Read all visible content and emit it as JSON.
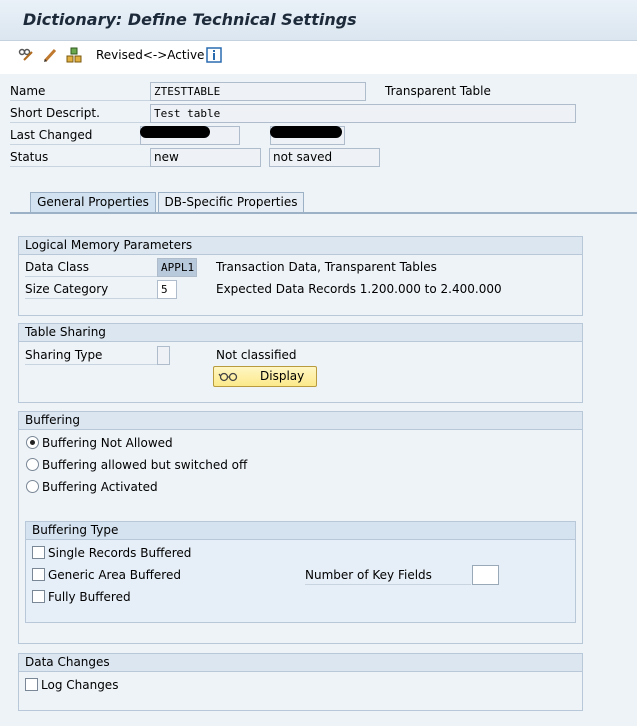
{
  "window": {
    "title": "Dictionary: Define Technical Settings"
  },
  "toolbar": {
    "revised_active_label": "Revised<->Active"
  },
  "header_fields": {
    "name_label": "Name",
    "name_value": "ZTESTTABLE",
    "table_type": "Transparent Table",
    "short_desc_label": "Short Descript.",
    "short_desc_value": "Test table",
    "last_changed_label": "Last Changed",
    "status_label": "Status",
    "status_value": "new",
    "save_status_value": "not saved"
  },
  "tabs": [
    {
      "label": "General Properties",
      "active": true
    },
    {
      "label": "DB-Specific Properties",
      "active": false
    }
  ],
  "logical_memory": {
    "title": "Logical Memory Parameters",
    "data_class_label": "Data Class",
    "data_class_value": "APPL1",
    "data_class_desc": "Transaction Data, Transparent Tables",
    "size_category_label": "Size Category",
    "size_category_value": "5",
    "size_category_desc": "Expected Data Records 1.200.000 to 2.400.000"
  },
  "table_sharing": {
    "title": "Table Sharing",
    "sharing_type_label": "Sharing Type",
    "sharing_type_value": "",
    "sharing_desc": "Not classified",
    "display_button": "Display"
  },
  "buffering": {
    "title": "Buffering",
    "options": [
      {
        "label": "Buffering Not Allowed",
        "selected": true
      },
      {
        "label": "Buffering allowed but switched off",
        "selected": false
      },
      {
        "label": "Buffering Activated",
        "selected": false
      }
    ],
    "type_title": "Buffering Type",
    "types": [
      {
        "label": "Single Records Buffered",
        "checked": false
      },
      {
        "label": "Generic Area Buffered",
        "checked": false
      },
      {
        "label": "Fully Buffered",
        "checked": false
      }
    ],
    "key_fields_label": "Number of Key Fields",
    "key_fields_value": ""
  },
  "data_changes": {
    "title": "Data Changes",
    "log_changes_label": "Log Changes",
    "log_changes_checked": false
  },
  "colors": {
    "title_bg": "#dbe6f0",
    "form_bg": "#eef3f8",
    "button_yellow": "#fce98a",
    "group_border": "#b8c8d8"
  }
}
